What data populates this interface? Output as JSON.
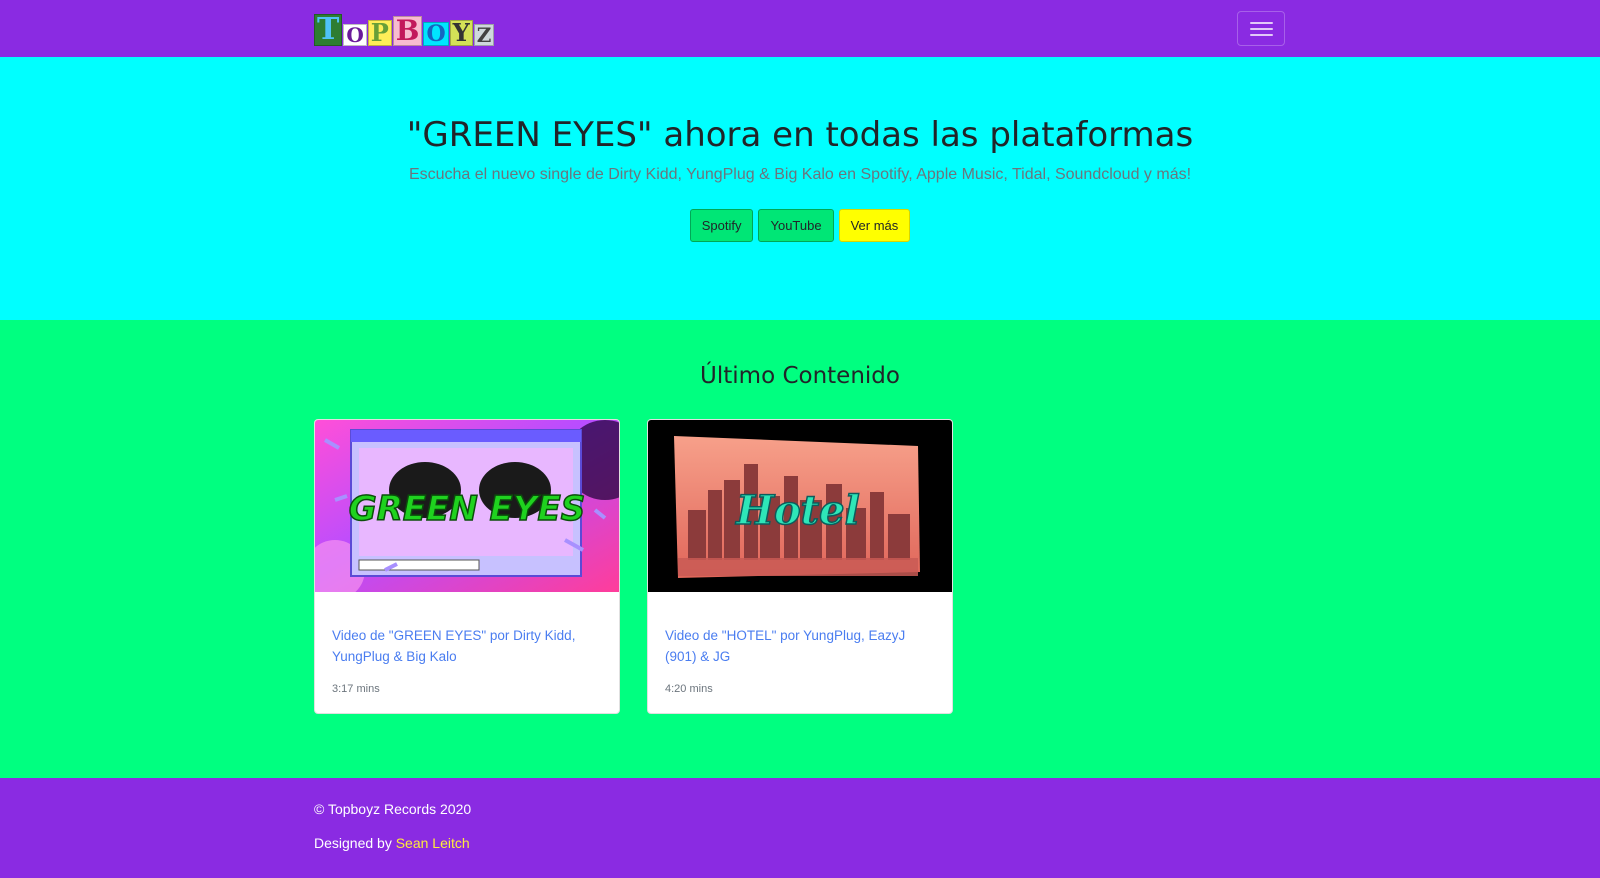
{
  "navbar": {
    "brand_letters": [
      "T",
      "O",
      "P",
      "B",
      "O",
      "Y",
      "Z"
    ],
    "brand_colors": [
      "#4fc3f7",
      "#ffffff",
      "#8bc34a",
      "#e91e63",
      "#2196f3",
      "#ffeb3b",
      "#9e9e9e"
    ],
    "toggler_icon": "hamburger-icon"
  },
  "hero": {
    "title": "\"GREEN EYES\" ahora en todas las plataformas",
    "subtitle": "Escucha el nuevo single de Dirty Kidd, YungPlug & Big Kalo en Spotify, Apple Music, Tidal, Soundcloud y más!",
    "buttons": {
      "spotify": "Spotify",
      "youtube": "YouTube",
      "more": "Ver más"
    }
  },
  "latest": {
    "heading": "Último Contenido",
    "cards": [
      {
        "thumbnail_text": "GREEN EYES",
        "title": "Video de \"GREEN EYES\" por Dirty Kidd, YungPlug & Big Kalo",
        "duration": "3:17 mins"
      },
      {
        "thumbnail_text": "Hotel",
        "title": "Video de \"HOTEL\" por YungPlug, EazyJ (901) & JG",
        "duration": "4:20 mins"
      }
    ]
  },
  "footer": {
    "copyright": "© Topboyz Records 2020",
    "designed_prefix": "Designed by ",
    "designer": "Sean Leitch"
  },
  "colors": {
    "navbar": "#8a2be2",
    "hero_bg": "#00ffff",
    "content_bg": "#00ff80",
    "button_green": "#00e676",
    "button_yellow": "#ffff00",
    "link": "#4a7df0",
    "footer_link": "#ffeb3b"
  }
}
